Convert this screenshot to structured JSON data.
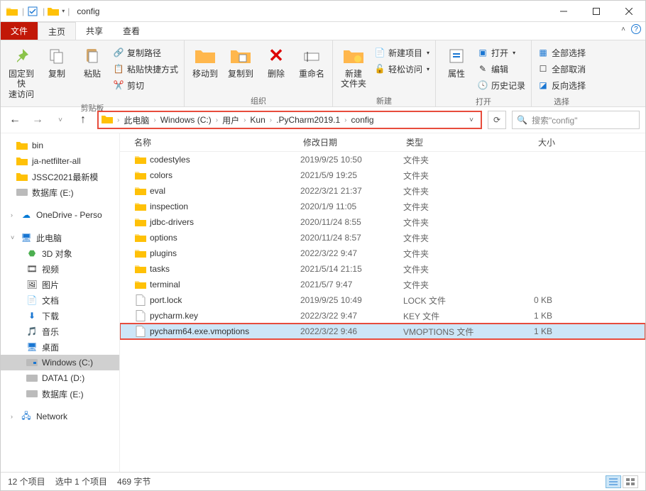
{
  "window": {
    "title": "config"
  },
  "tabs": {
    "file": "文件",
    "home": "主页",
    "share": "共享",
    "view": "查看"
  },
  "ribbon": {
    "clipboard": {
      "pin": "固定到快\n速访问",
      "copy": "复制",
      "paste": "粘贴",
      "copy_path": "复制路径",
      "paste_shortcut": "粘贴快捷方式",
      "cut": "剪切",
      "group": "剪贴板"
    },
    "organize": {
      "move_to": "移动到",
      "copy_to": "复制到",
      "delete": "删除",
      "rename": "重命名",
      "group": "组织"
    },
    "new": {
      "new_folder": "新建\n文件夹",
      "new_item": "新建项目",
      "easy_access": "轻松访问",
      "group": "新建"
    },
    "open": {
      "properties": "属性",
      "open": "打开",
      "edit": "编辑",
      "history": "历史记录",
      "group": "打开"
    },
    "select": {
      "select_all": "全部选择",
      "select_none": "全部取消",
      "invert": "反向选择",
      "group": "选择"
    }
  },
  "breadcrumb": {
    "items": [
      "此电脑",
      "Windows (C:)",
      "用户",
      "Kun",
      ".PyCharm2019.1",
      "config"
    ]
  },
  "search": {
    "placeholder": "搜索\"config\""
  },
  "sidebar": {
    "bin": "bin",
    "ja": "ja-netfilter-all",
    "jssc": "JSSC2021最新模",
    "db": "数据库 (E:)",
    "onedrive": "OneDrive - Perso",
    "thispc": "此电脑",
    "obj3d": "3D 对象",
    "videos": "视频",
    "pictures": "图片",
    "docs": "文档",
    "downloads": "下载",
    "music": "音乐",
    "desktop": "桌面",
    "winc": "Windows (C:)",
    "data1": "DATA1 (D:)",
    "dbe": "数据库 (E:)",
    "network": "Network"
  },
  "columns": {
    "name": "名称",
    "date": "修改日期",
    "type": "类型",
    "size": "大小"
  },
  "files": [
    {
      "name": "codestyles",
      "date": "2019/9/25 10:50",
      "type": "文件夹",
      "size": "",
      "kind": "folder"
    },
    {
      "name": "colors",
      "date": "2021/5/9 19:25",
      "type": "文件夹",
      "size": "",
      "kind": "folder"
    },
    {
      "name": "eval",
      "date": "2022/3/21 21:37",
      "type": "文件夹",
      "size": "",
      "kind": "folder"
    },
    {
      "name": "inspection",
      "date": "2020/1/9 11:05",
      "type": "文件夹",
      "size": "",
      "kind": "folder"
    },
    {
      "name": "jdbc-drivers",
      "date": "2020/11/24 8:55",
      "type": "文件夹",
      "size": "",
      "kind": "folder"
    },
    {
      "name": "options",
      "date": "2020/11/24 8:57",
      "type": "文件夹",
      "size": "",
      "kind": "folder"
    },
    {
      "name": "plugins",
      "date": "2022/3/22 9:47",
      "type": "文件夹",
      "size": "",
      "kind": "folder"
    },
    {
      "name": "tasks",
      "date": "2021/5/14 21:15",
      "type": "文件夹",
      "size": "",
      "kind": "folder"
    },
    {
      "name": "terminal",
      "date": "2021/5/7 9:47",
      "type": "文件夹",
      "size": "",
      "kind": "folder"
    },
    {
      "name": "port.lock",
      "date": "2019/9/25 10:49",
      "type": "LOCK 文件",
      "size": "0 KB",
      "kind": "file"
    },
    {
      "name": "pycharm.key",
      "date": "2022/3/22 9:47",
      "type": "KEY 文件",
      "size": "1 KB",
      "kind": "file"
    },
    {
      "name": "pycharm64.exe.vmoptions",
      "date": "2022/3/22 9:46",
      "type": "VMOPTIONS 文件",
      "size": "1 KB",
      "kind": "file",
      "selected": true
    }
  ],
  "status": {
    "count": "12 个项目",
    "sel": "选中 1 个项目",
    "bytes": "469 字节"
  }
}
